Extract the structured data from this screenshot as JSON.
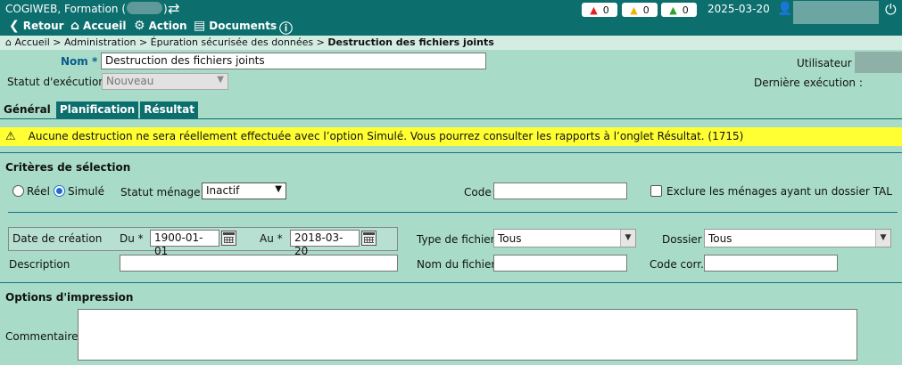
{
  "topbar": {
    "app_title_prefix": "COGIWEB, Formation (",
    "app_title_suffix": ")",
    "menu": {
      "back": "Retour",
      "home": "Accueil",
      "action": "Action",
      "documents": "Documents"
    },
    "alerts": {
      "red": "0",
      "yellow": "0",
      "green": "0"
    },
    "date": "2025-03-20"
  },
  "breadcrumb": {
    "path": "Accueil > Administration > Épuration sécurisée des données > ",
    "current": "Destruction des fichiers joints"
  },
  "header": {
    "nom_label": "Nom",
    "nom_required": "*",
    "nom_value": "Destruction des fichiers joints",
    "statut_execution_label": "Statut d'exécution",
    "statut_execution_value": "Nouveau",
    "utilisateur_label": "Utilisateur :",
    "derniere_execution_label": "Dernière exécution :"
  },
  "tabs": [
    "Général",
    "Planification",
    "Résultat"
  ],
  "warning": {
    "icon": "warning-icon",
    "text": "Aucune destruction ne sera réellement effectuée avec l’option Simulé. Vous pourrez consulter les rapports à l’onglet Résultat. (1715)"
  },
  "criteria": {
    "title": "Critères de sélection",
    "radio_reel": "Réel",
    "radio_simule": "Simulé",
    "statut_menage_label": "Statut ménage",
    "statut_menage_value": "Inactif",
    "code_label": "Code",
    "exclure_label": "Exclure les ménages ayant un dossier TAL",
    "date_creation_label": "Date de création",
    "du_label": "Du *",
    "du_value": "1900-01-01",
    "au_label": "Au *",
    "au_value": "2018-03-20",
    "type_fichier_label": "Type de fichier",
    "type_fichier_value": "Tous",
    "dossier_label": "Dossier",
    "dossier_value": "Tous",
    "description_label": "Description",
    "nom_fichier_label": "Nom du fichier",
    "code_corr_label": "Code corr."
  },
  "print_options": {
    "title": "Options d'impression",
    "commentaire_label": "Commentaire"
  },
  "colors": {
    "header_bg": "#0d6e6e",
    "page_bg": "#a8dcc8",
    "warning_bg": "#ffff33",
    "label_blue": "#0a5a8c"
  }
}
